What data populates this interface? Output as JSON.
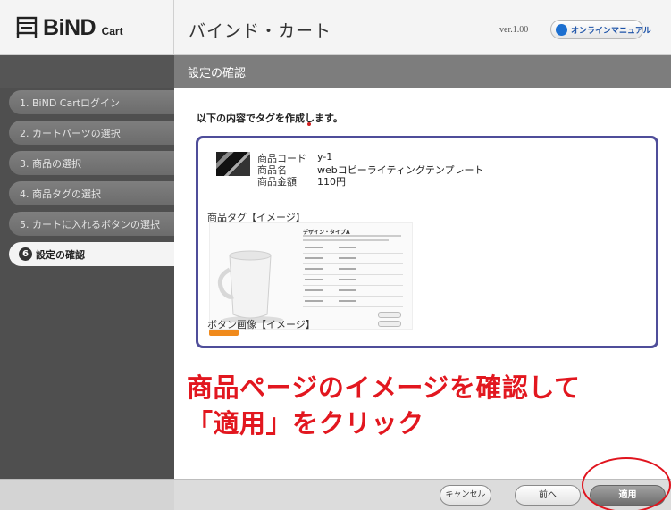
{
  "header": {
    "logo_main": "BiND",
    "logo_sub": "Cart",
    "app_title": "バインド・カート",
    "version": "ver.1.00",
    "manual_button": "オンラインマニュアル"
  },
  "sidebar": {
    "steps": [
      {
        "label": "1.  BiND Cartログイン"
      },
      {
        "label": "2.  カートパーツの選択"
      },
      {
        "label": "3.  商品の選択"
      },
      {
        "label": "4.  商品タグの選択"
      },
      {
        "label": "5.  カートに入れるボタンの選択"
      },
      {
        "number": "6",
        "label": "設定の確認"
      }
    ]
  },
  "section": {
    "title": "設定の確認"
  },
  "main": {
    "intro": "以下の内容でタグを作成します。",
    "product": {
      "code_key": "商品コード",
      "code_val": "y-1",
      "name_key": "商品名",
      "name_val": "webコピーライティングテンプレート",
      "price_key": "商品金額",
      "price_val": "110円"
    },
    "tag_label": "商品タグ【イメージ】",
    "preview_title": "デザイン・タイプA",
    "button_label": "ボタン画像【イメージ】",
    "annotation_line1": "商品ページのイメージを確認して",
    "annotation_line2": "「適用」をクリック"
  },
  "footer": {
    "cancel": "キャンセル",
    "prev": "前へ",
    "apply": "適用"
  },
  "colors": {
    "accent_border": "#4f4e9a",
    "annotation_red": "#e2171f",
    "sidebar_bg": "#4f4f4f"
  }
}
